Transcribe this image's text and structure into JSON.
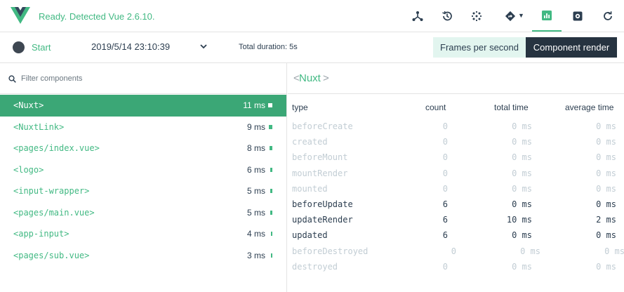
{
  "header": {
    "status": "Ready. Detected Vue 2.6.10.",
    "buttons": [
      {
        "icon": "components-tree-icon"
      },
      {
        "icon": "history-icon"
      },
      {
        "icon": "vuex-dots-icon"
      },
      {
        "icon": "routing-icon"
      },
      {
        "icon": "performance-chart-icon",
        "active": true
      },
      {
        "icon": "settings-icon"
      },
      {
        "icon": "refresh-icon"
      }
    ]
  },
  "toolbar": {
    "start_label": "Start",
    "date": "2019/5/14 23:10:39",
    "duration": "Total duration: 5s",
    "mode_fps": "Frames per second",
    "mode_component": "Component render"
  },
  "filter": {
    "placeholder": "Filter components"
  },
  "components": [
    {
      "name": "<Nuxt>",
      "time": "11 ms",
      "share": 1.0,
      "selected": true
    },
    {
      "name": "<NuxtLink>",
      "time": "9 ms",
      "share": 0.82
    },
    {
      "name": "<pages/index.vue>",
      "time": "8 ms",
      "share": 0.73
    },
    {
      "name": "<logo>",
      "time": "6 ms",
      "share": 0.55
    },
    {
      "name": "<input-wrapper>",
      "time": "5 ms",
      "share": 0.45
    },
    {
      "name": "<pages/main.vue>",
      "time": "5 ms",
      "share": 0.45
    },
    {
      "name": "<app-input>",
      "time": "4 ms",
      "share": 0.36
    },
    {
      "name": "<pages/sub.vue>",
      "time": "3 ms",
      "share": 0.27
    }
  ],
  "detail": {
    "open_bracket": "<",
    "name": "Nuxt",
    "close_bracket": ">",
    "columns": [
      "type",
      "count",
      "total time",
      "average time"
    ],
    "rows": [
      {
        "type": "beforeCreate",
        "count": "0",
        "total": "0 ms",
        "avg": "0 ms",
        "active": false
      },
      {
        "type": "created",
        "count": "0",
        "total": "0 ms",
        "avg": "0 ms",
        "active": false
      },
      {
        "type": "beforeMount",
        "count": "0",
        "total": "0 ms",
        "avg": "0 ms",
        "active": false
      },
      {
        "type": "mountRender",
        "count": "0",
        "total": "0 ms",
        "avg": "0 ms",
        "active": false
      },
      {
        "type": "mounted",
        "count": "0",
        "total": "0 ms",
        "avg": "0 ms",
        "active": false
      },
      {
        "type": "beforeUpdate",
        "count": "6",
        "total": "0 ms",
        "avg": "0 ms",
        "active": true
      },
      {
        "type": "updateRender",
        "count": "6",
        "total": "10 ms",
        "avg": "2 ms",
        "active": true
      },
      {
        "type": "updated",
        "count": "6",
        "total": "0 ms",
        "avg": "0 ms",
        "active": true
      },
      {
        "type": "beforeDestroyed",
        "count": "0",
        "total": "0 ms",
        "avg": "0 ms",
        "active": false
      },
      {
        "type": "destroyed",
        "count": "0",
        "total": "0 ms",
        "avg": "0 ms",
        "active": false
      }
    ]
  },
  "colors": {
    "accent": "#42b983",
    "selected_row": "#3ba776",
    "dark": "#263340"
  }
}
